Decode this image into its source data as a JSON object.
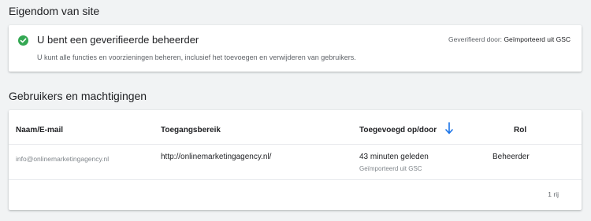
{
  "ownership": {
    "section_title": "Eigendom van site",
    "verified_title": "U bent een geverifieerde beheerder",
    "verified_desc": "U kunt alle functies en voorzieningen beheren, inclusief het toevoegen en verwijderen van gebruikers.",
    "verified_by_label": "Geverifieerd door:",
    "verified_by_value": "Geïmporteerd uit GSC",
    "status_color": "#34a853",
    "status_icon": "check-circle-icon"
  },
  "users": {
    "section_title": "Gebruikers en machtigingen",
    "columns": [
      "Naam/E-mail",
      "Toegangsbereik",
      "Toegevoegd op/door",
      "Rol"
    ],
    "sort_icon": "arrow-down-icon",
    "sort_color": "#1a73e8",
    "rows": [
      {
        "email": "info@onlinemarketingagency.nl",
        "scope": "http://onlinemarketingagency.nl/",
        "added": "43 minuten geleden",
        "added_by": "Geïmporteerd uit GSC",
        "role": "Beheerder"
      }
    ],
    "row_count": "1 rij"
  }
}
